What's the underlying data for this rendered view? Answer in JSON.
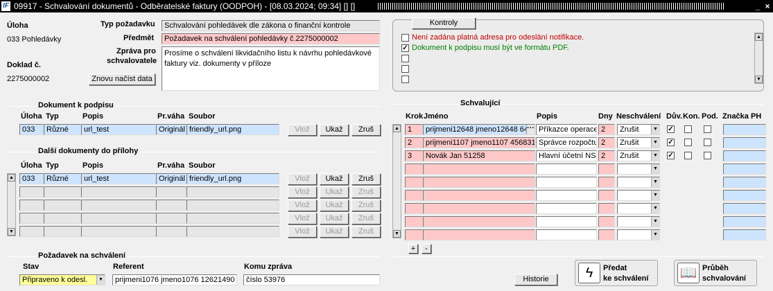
{
  "window": {
    "title": "09917 - Schvalování dokumentů - Odběratelské faktury (OODPOH) - [08.03.2024; 09:34] [] []",
    "logo": "IF",
    "minimize": "_",
    "close": "×"
  },
  "header": {
    "uloha_label": "Úloha",
    "uloha_value": "033 Pohledávky",
    "doklad_label": "Doklad č.",
    "doklad_value": "2275000002",
    "typ_label": "Typ požadavku",
    "typ_value": "Schvalování pohledávek dle zákona o finanční kontrole",
    "predmet_label": "Předmět",
    "predmet_value": "Požadavek na schválení pohledávky č.2275000002",
    "zprava_label1": "Zpráva pro",
    "zprava_label2": "schvalovatele",
    "zprava_value": "Prosíme o schválení likvidačního listu k návrhu pohledávkové faktury viz. dokumenty v příloze",
    "reload_button": "Znovu načíst data"
  },
  "kontroly": {
    "button": "Kontroly",
    "items": [
      {
        "text": "Není zadána platná adresa pro odeslání notifikace.",
        "checked": false,
        "color": "#c00000"
      },
      {
        "text": "Dokument k podpisu musí být ve formátu PDF.",
        "checked": true,
        "color": "#008000"
      },
      {
        "text": "",
        "checked": false
      },
      {
        "text": "",
        "checked": false
      },
      {
        "text": "",
        "checked": false
      }
    ]
  },
  "doc_sign": {
    "section": "Dokument k podpisu",
    "headers": [
      "Úloha",
      "Typ",
      "Popis",
      "Pr.váha",
      "Soubor"
    ],
    "row": {
      "uloha": "033",
      "typ": "Různé",
      "popis": "url_test",
      "vaha": "Originál",
      "soubor": "friendly_url.png"
    },
    "buttons": [
      "Vlož",
      "Ukaž",
      "Zruš"
    ]
  },
  "doc_attach": {
    "section": "Další dokumenty do přílohy",
    "headers": [
      "Úloha",
      "Typ",
      "Popis",
      "Pr.váha",
      "Soubor"
    ],
    "row": {
      "uloha": "033",
      "typ": "Různé",
      "popis": "url_test",
      "vaha": "Originál",
      "soubor": "friendly_url.png"
    },
    "buttons": [
      "Vlož",
      "Ukaž",
      "Zruš"
    ]
  },
  "request": {
    "section": "Požadavek na schválení",
    "stav_label": "Stav",
    "stav_value": "Připraveno k odesl.",
    "referent_label": "Referent",
    "referent_value": "prijmeni1076 jmeno1076 12621490",
    "komu_label": "Komu zpráva",
    "komu_value": "číslo 53976",
    "historie": "Historie"
  },
  "approvers": {
    "section": "Schvalující",
    "headers": [
      "Krok",
      "Jméno",
      "Popis",
      "Dny",
      "Neschválení",
      "Dův.",
      "Kon.",
      "Pod.",
      "Značka PH"
    ],
    "rows": [
      {
        "krok": "1",
        "jmeno": "prijmeni12648 jmeno12648 64",
        "popis": "Příkazce operace",
        "dny": "2",
        "nesch": "Zrušit",
        "duv": true
      },
      {
        "krok": "2",
        "jmeno": "prijmeni1107 jmeno1107 456831",
        "popis": "Správce rozpočtu",
        "dny": "2",
        "nesch": "Zrušit",
        "duv": true
      },
      {
        "krok": "3",
        "jmeno": "Novák Jan 51258",
        "popis": "Hlavní účetní NS",
        "dny": "2",
        "nesch": "Zrušit",
        "duv": true
      }
    ],
    "add": "+",
    "remove": "-"
  },
  "actions": {
    "predat1": "Předat",
    "predat2": "ke schválení",
    "prubeh1": "Průběh",
    "prubeh2": "schvalování"
  }
}
